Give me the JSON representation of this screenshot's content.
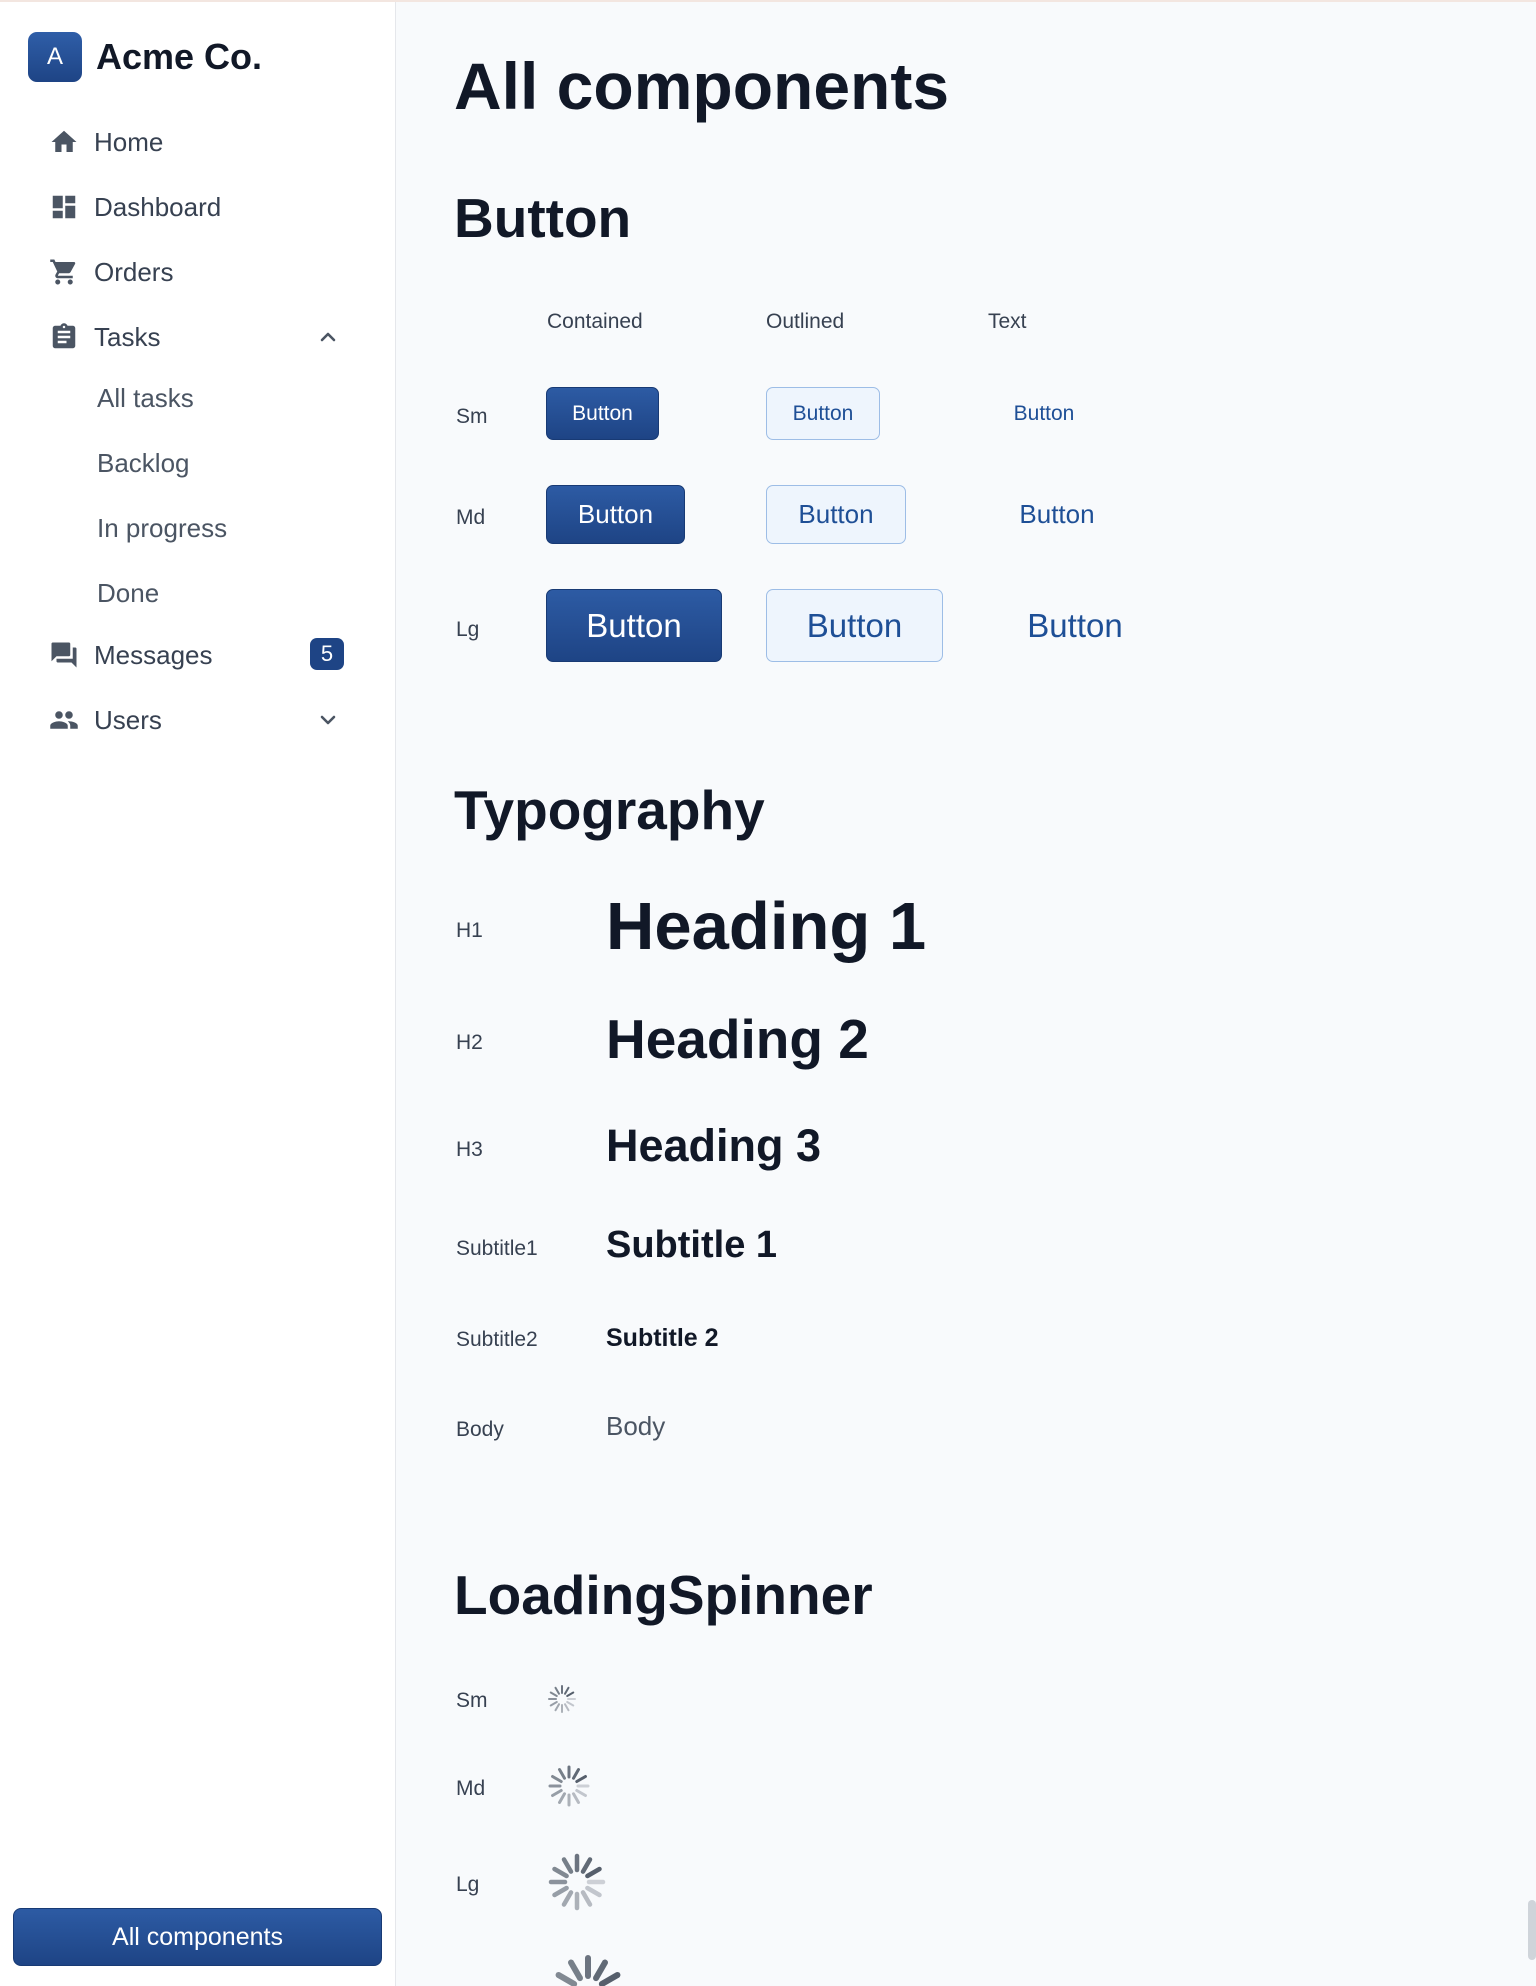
{
  "brand": {
    "logo_letter": "A",
    "name": "Acme Co."
  },
  "sidebar": {
    "items": [
      {
        "label": "Home",
        "icon": "home-icon"
      },
      {
        "label": "Dashboard",
        "icon": "dashboard-icon"
      },
      {
        "label": "Orders",
        "icon": "cart-icon"
      },
      {
        "label": "Tasks",
        "icon": "clipboard-icon",
        "expanded": true,
        "children": [
          "All tasks",
          "Backlog",
          "In progress",
          "Done"
        ]
      },
      {
        "label": "Messages",
        "icon": "chat-icon",
        "badge": "5"
      },
      {
        "label": "Users",
        "icon": "users-icon",
        "expanded": false
      }
    ],
    "bottom_button": "All components"
  },
  "page": {
    "title": "All components"
  },
  "button_section": {
    "title": "Button",
    "columns": [
      "Contained",
      "Outlined",
      "Text"
    ],
    "rows": [
      "Sm",
      "Md",
      "Lg"
    ],
    "button_label": "Button"
  },
  "typography_section": {
    "title": "Typography",
    "rows": [
      {
        "label": "H1",
        "sample": "Heading 1"
      },
      {
        "label": "H2",
        "sample": "Heading 2"
      },
      {
        "label": "H3",
        "sample": "Heading 3"
      },
      {
        "label": "Subtitle1",
        "sample": "Subtitle 1"
      },
      {
        "label": "Subtitle2",
        "sample": "Subtitle 2"
      },
      {
        "label": "Body",
        "sample": "Body"
      }
    ]
  },
  "spinner_section": {
    "title": "LoadingSpinner",
    "rows": [
      "Sm",
      "Md",
      "Lg"
    ]
  },
  "colors": {
    "primary": "#1e4485",
    "outline": "#9dbde6",
    "text_primary": "#111827"
  }
}
